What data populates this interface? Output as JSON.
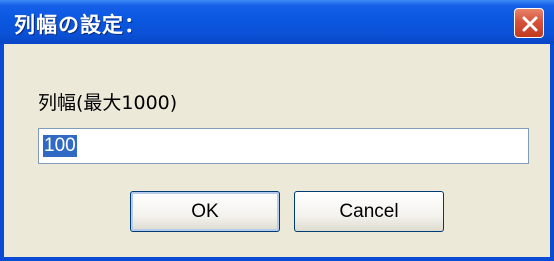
{
  "dialog": {
    "title": "列幅の設定：",
    "close_icon": "close-icon",
    "field_label": "列幅(最大1000)",
    "field_value": "100",
    "field_value_selected": true,
    "ok_label": "OK",
    "cancel_label": "Cancel"
  },
  "colors": {
    "titlebar": "#0a57e0",
    "close_button": "#d6533a",
    "dialog_background": "#ece9d8",
    "selection": "#316ac5"
  }
}
